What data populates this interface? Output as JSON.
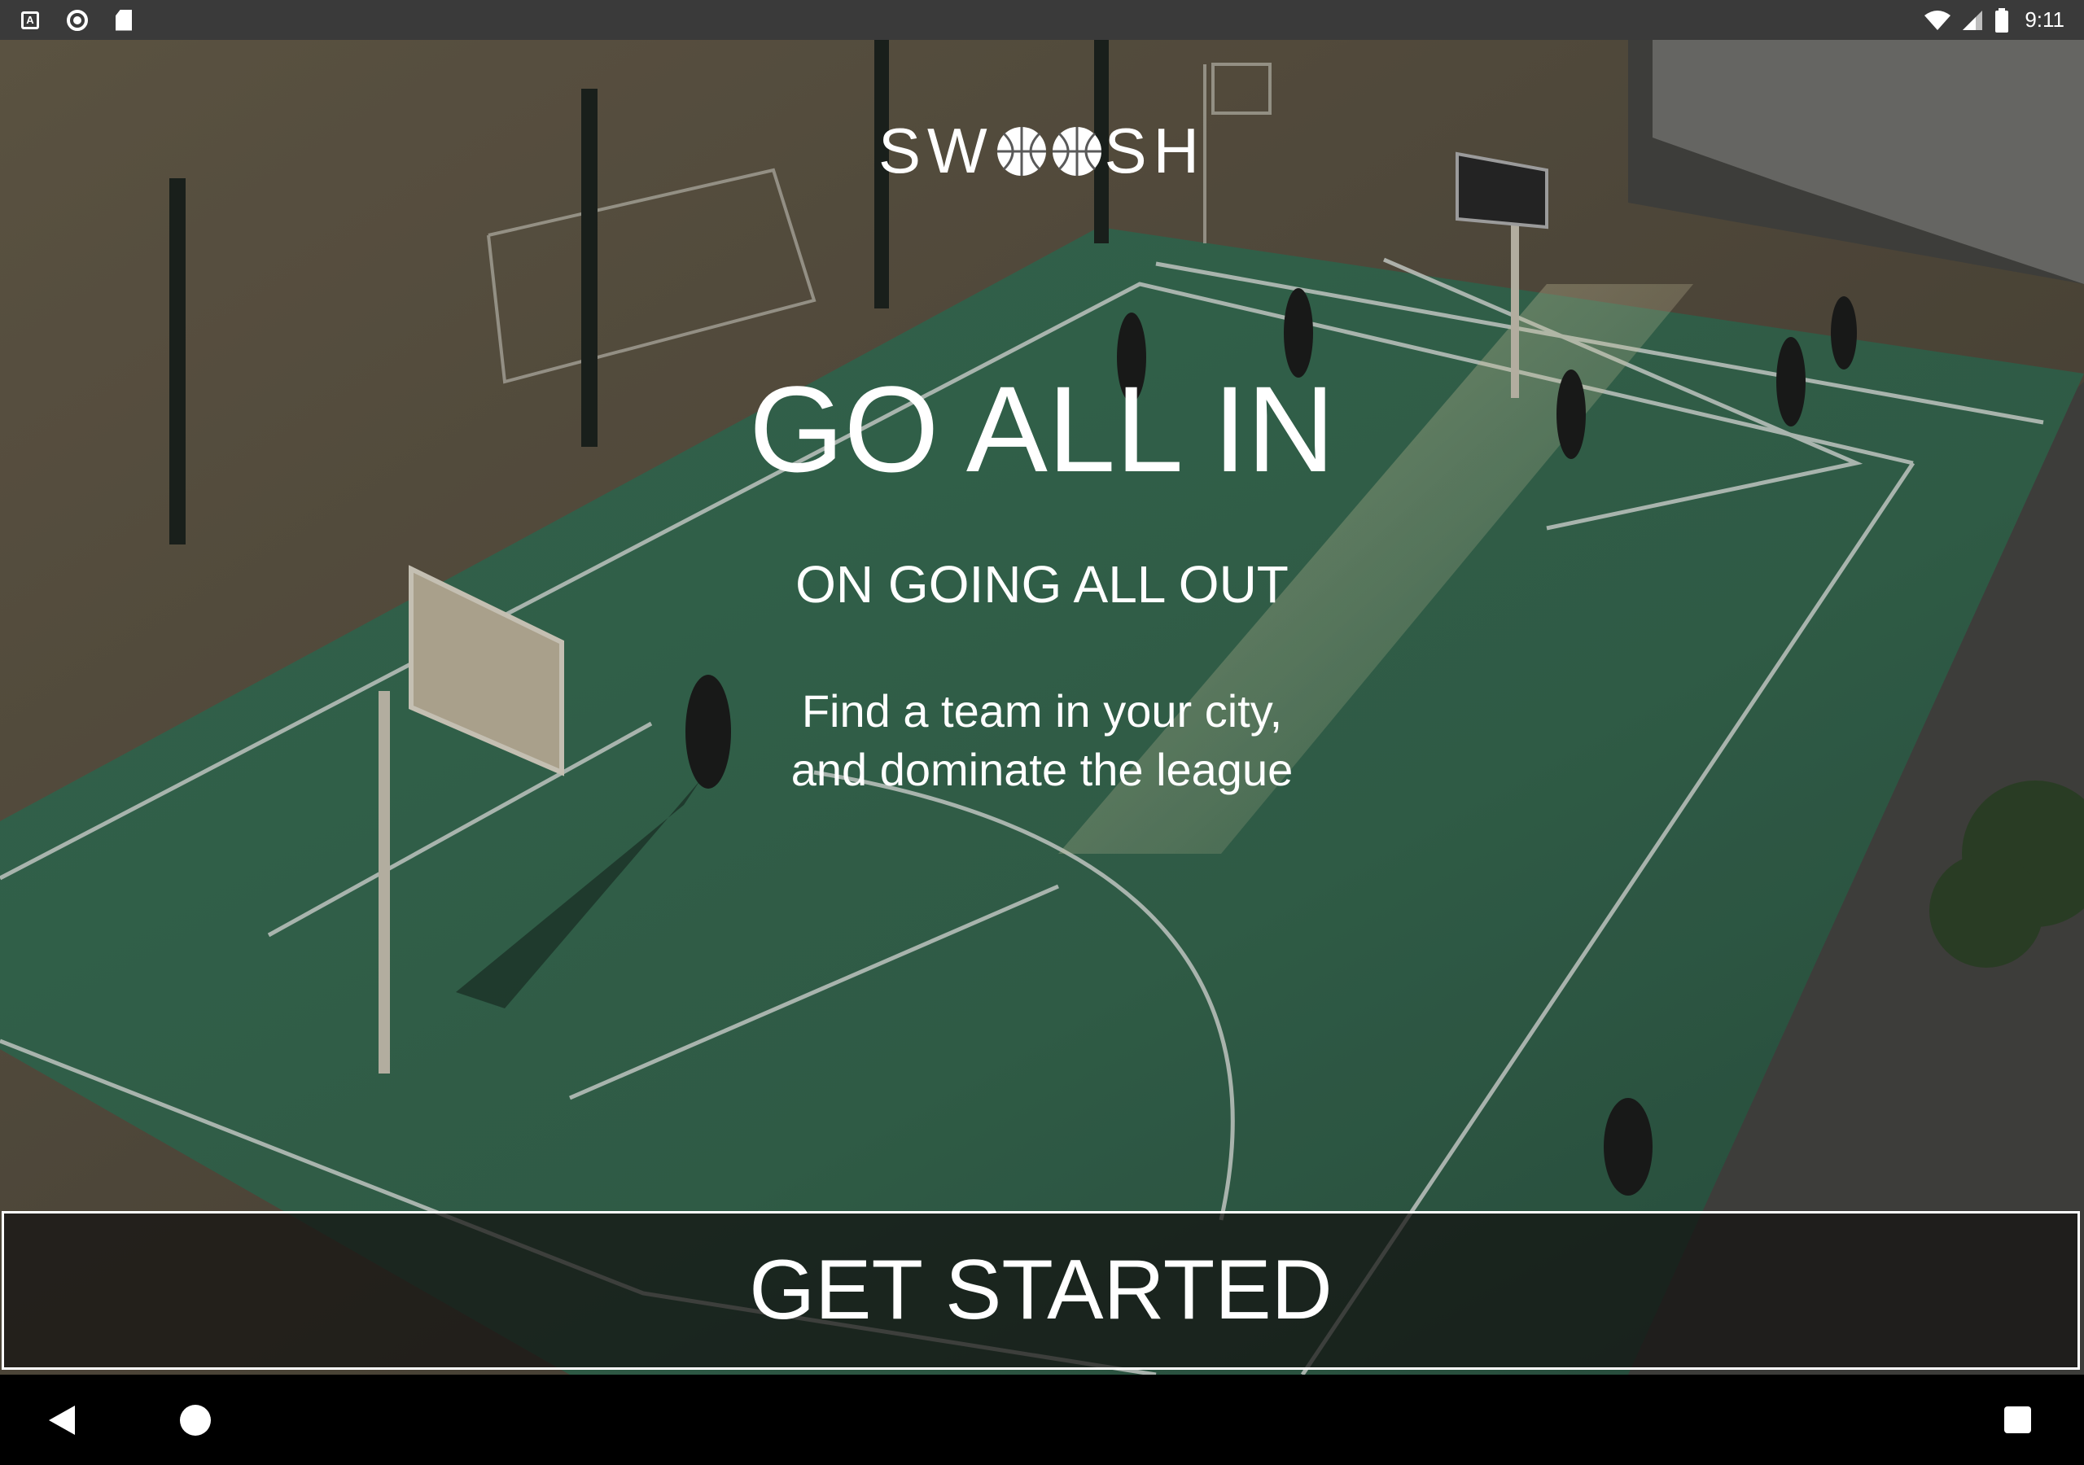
{
  "status_bar": {
    "left_icons": [
      "text-format-icon",
      "sync-circle-icon",
      "sd-card-icon"
    ],
    "a_glyph": "A",
    "right_icons": [
      "wifi-icon",
      "signal-icon",
      "battery-icon"
    ],
    "time": "9:11"
  },
  "logo": {
    "part1": "SW",
    "part2": "SH",
    "ball_icons": [
      "basketball-icon",
      "basketball-icon"
    ]
  },
  "hero": {
    "headline": "GO ALL IN",
    "subheadline": "ON GOING ALL OUT",
    "tagline_line1": "Find a team in your city,",
    "tagline_line2": "and dominate the league"
  },
  "cta": {
    "label": "GET STARTED"
  },
  "nav_bar": {
    "buttons": [
      "back-icon",
      "home-icon",
      "recents-icon"
    ]
  },
  "colors": {
    "court_green": "#3f7a5e",
    "status_bar": "#3a3a3a",
    "text": "#ffffff"
  }
}
